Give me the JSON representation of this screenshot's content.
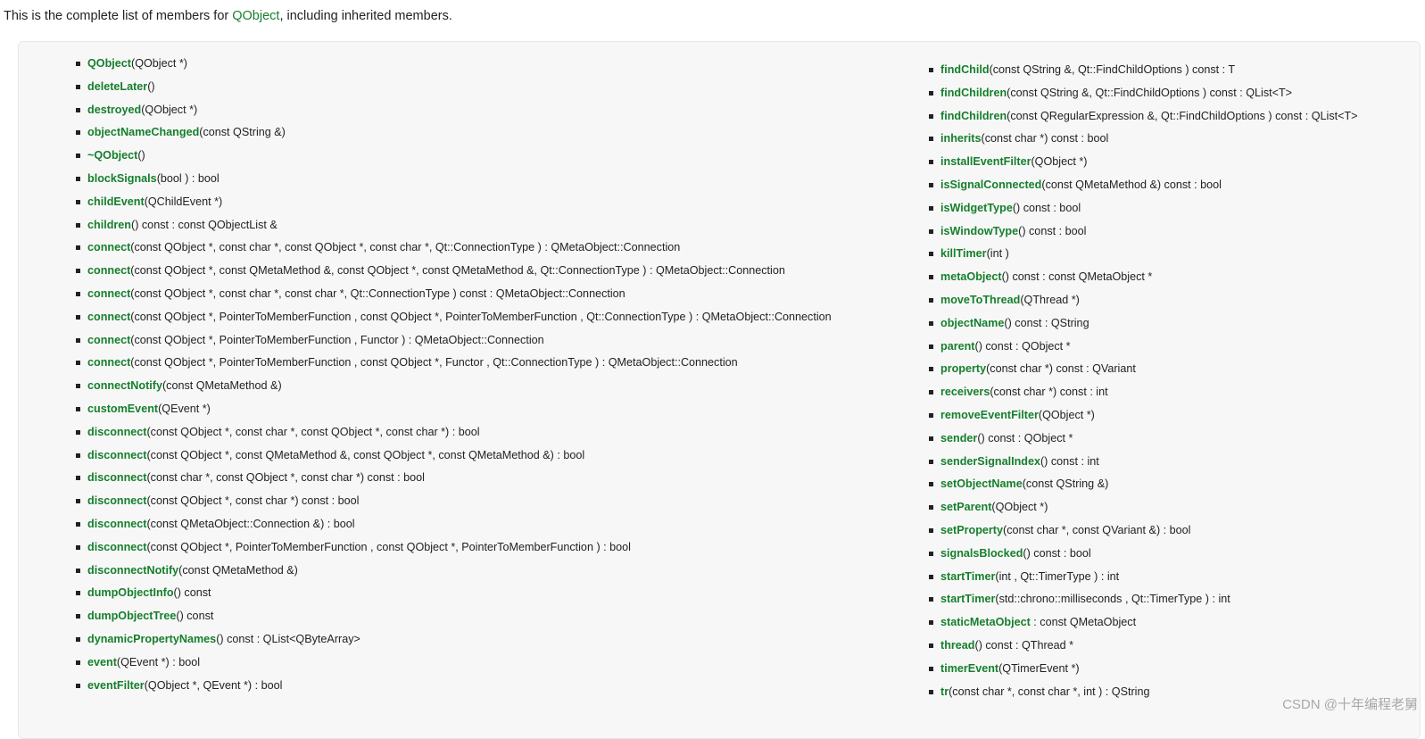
{
  "intro": {
    "prefix": "This is the complete list of members for ",
    "link": "QObject",
    "suffix": ", including inherited members."
  },
  "left_members": [
    {
      "name": "QObject",
      "sig": "(QObject *)"
    },
    {
      "name": "deleteLater",
      "sig": "()"
    },
    {
      "name": "destroyed",
      "sig": "(QObject *)"
    },
    {
      "name": "objectNameChanged",
      "sig": "(const QString &)"
    },
    {
      "name": "~QObject",
      "sig": "()"
    },
    {
      "name": "blockSignals",
      "sig": "(bool ) : bool"
    },
    {
      "name": "childEvent",
      "sig": "(QChildEvent *)"
    },
    {
      "name": "children",
      "sig": "() const : const QObjectList &"
    },
    {
      "name": "connect",
      "sig": "(const QObject *, const char *, const QObject *, const char *, Qt::ConnectionType ) : QMetaObject::Connection"
    },
    {
      "name": "connect",
      "sig": "(const QObject *, const QMetaMethod &, const QObject *, const QMetaMethod &, Qt::ConnectionType ) : QMetaObject::Connection"
    },
    {
      "name": "connect",
      "sig": "(const QObject *, const char *, const char *, Qt::ConnectionType ) const : QMetaObject::Connection"
    },
    {
      "name": "connect",
      "sig": "(const QObject *, PointerToMemberFunction , const QObject *, PointerToMemberFunction , Qt::ConnectionType ) : QMetaObject::Connection"
    },
    {
      "name": "connect",
      "sig": "(const QObject *, PointerToMemberFunction , Functor ) : QMetaObject::Connection"
    },
    {
      "name": "connect",
      "sig": "(const QObject *, PointerToMemberFunction , const QObject *, Functor , Qt::ConnectionType ) : QMetaObject::Connection"
    },
    {
      "name": "connectNotify",
      "sig": "(const QMetaMethod &)"
    },
    {
      "name": "customEvent",
      "sig": "(QEvent *)"
    },
    {
      "name": "disconnect",
      "sig": "(const QObject *, const char *, const QObject *, const char *) : bool"
    },
    {
      "name": "disconnect",
      "sig": "(const QObject *, const QMetaMethod &, const QObject *, const QMetaMethod &) : bool"
    },
    {
      "name": "disconnect",
      "sig": "(const char *, const QObject *, const char *) const : bool"
    },
    {
      "name": "disconnect",
      "sig": "(const QObject *, const char *) const : bool"
    },
    {
      "name": "disconnect",
      "sig": "(const QMetaObject::Connection &) : bool"
    },
    {
      "name": "disconnect",
      "sig": "(const QObject *, PointerToMemberFunction , const QObject *, PointerToMemberFunction ) : bool"
    },
    {
      "name": "disconnectNotify",
      "sig": "(const QMetaMethod &)"
    },
    {
      "name": "dumpObjectInfo",
      "sig": "() const"
    },
    {
      "name": "dumpObjectTree",
      "sig": "() const"
    },
    {
      "name": "dynamicPropertyNames",
      "sig": "() const : QList<QByteArray>"
    },
    {
      "name": "event",
      "sig": "(QEvent *) : bool"
    },
    {
      "name": "eventFilter",
      "sig": "(QObject *, QEvent *) : bool"
    }
  ],
  "right_members": [
    {
      "name": "findChild",
      "sig": "(const QString &, Qt::FindChildOptions ) const : T"
    },
    {
      "name": "findChildren",
      "sig": "(const QString &, Qt::FindChildOptions ) const : QList<T>"
    },
    {
      "name": "findChildren",
      "sig": "(const QRegularExpression &, Qt::FindChildOptions ) const : QList<T>"
    },
    {
      "name": "inherits",
      "sig": "(const char *) const : bool"
    },
    {
      "name": "installEventFilter",
      "sig": "(QObject *)"
    },
    {
      "name": "isSignalConnected",
      "sig": "(const QMetaMethod &) const : bool"
    },
    {
      "name": "isWidgetType",
      "sig": "() const : bool"
    },
    {
      "name": "isWindowType",
      "sig": "() const : bool"
    },
    {
      "name": "killTimer",
      "sig": "(int )"
    },
    {
      "name": "metaObject",
      "sig": "() const : const QMetaObject *"
    },
    {
      "name": "moveToThread",
      "sig": "(QThread *)"
    },
    {
      "name": "objectName",
      "sig": "() const : QString"
    },
    {
      "name": "parent",
      "sig": "() const : QObject *"
    },
    {
      "name": "property",
      "sig": "(const char *) const : QVariant"
    },
    {
      "name": "receivers",
      "sig": "(const char *) const : int"
    },
    {
      "name": "removeEventFilter",
      "sig": "(QObject *)"
    },
    {
      "name": "sender",
      "sig": "() const : QObject *"
    },
    {
      "name": "senderSignalIndex",
      "sig": "() const : int"
    },
    {
      "name": "setObjectName",
      "sig": "(const QString &)"
    },
    {
      "name": "setParent",
      "sig": "(QObject *)"
    },
    {
      "name": "setProperty",
      "sig": "(const char *, const QVariant &) : bool"
    },
    {
      "name": "signalsBlocked",
      "sig": "() const : bool"
    },
    {
      "name": "startTimer",
      "sig": "(int , Qt::TimerType ) : int"
    },
    {
      "name": "startTimer",
      "sig": "(std::chrono::milliseconds , Qt::TimerType ) : int"
    },
    {
      "name": "staticMetaObject",
      "sig": " : const QMetaObject"
    },
    {
      "name": "thread",
      "sig": "() const : QThread *"
    },
    {
      "name": "timerEvent",
      "sig": "(QTimerEvent *)"
    },
    {
      "name": "tr",
      "sig": "(const char *, const char *, int ) : QString"
    }
  ],
  "watermark": "CSDN @十年编程老舅"
}
